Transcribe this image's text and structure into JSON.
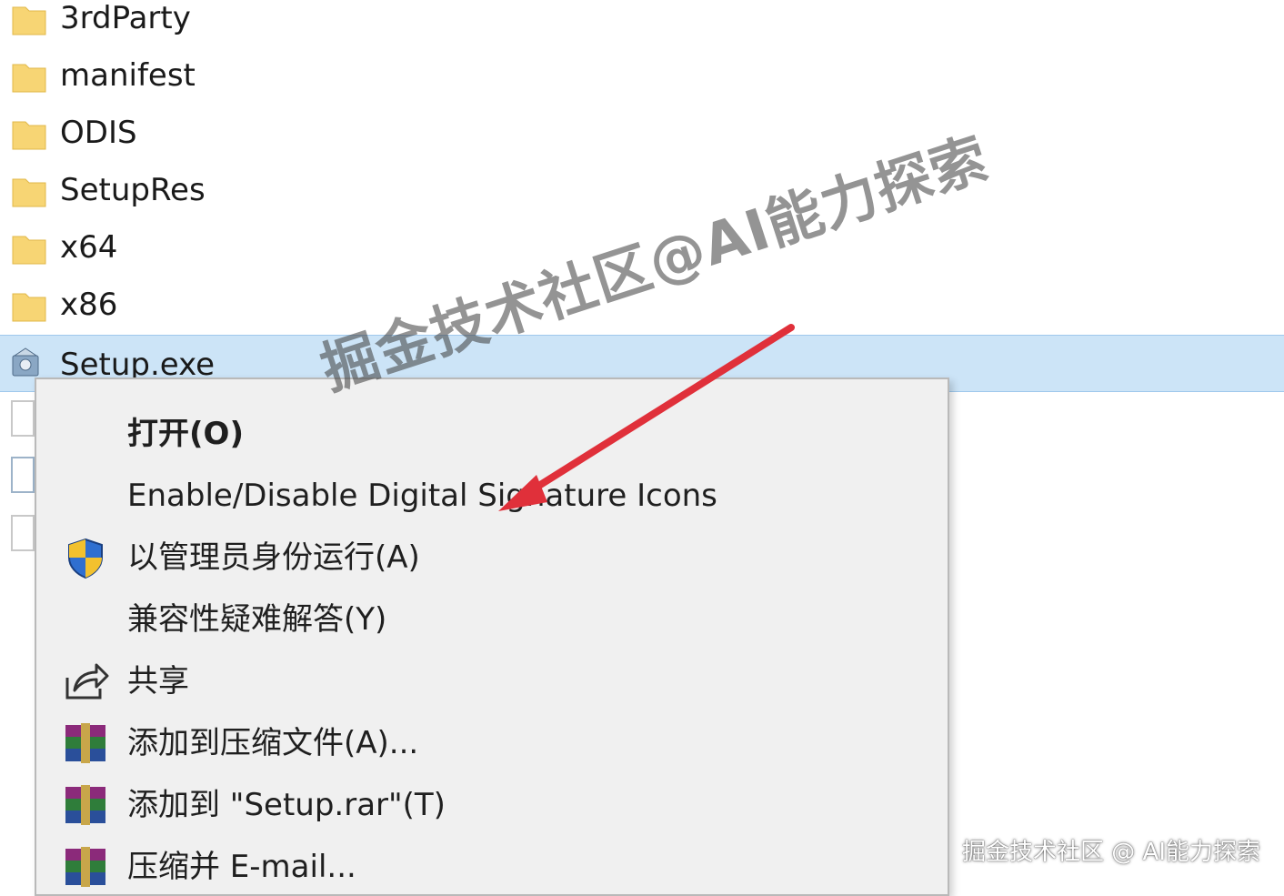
{
  "files": [
    {
      "name": "3rdParty",
      "type": "folder"
    },
    {
      "name": "manifest",
      "type": "folder"
    },
    {
      "name": "ODIS",
      "type": "folder"
    },
    {
      "name": "SetupRes",
      "type": "folder"
    },
    {
      "name": "x64",
      "type": "folder"
    },
    {
      "name": "x86",
      "type": "folder"
    },
    {
      "name": "Setup.exe",
      "type": "exe",
      "selected": true
    }
  ],
  "context_menu": {
    "items": [
      {
        "label": "打开(O)",
        "icon": null
      },
      {
        "label": "Enable/Disable Digital Signature Icons",
        "icon": null
      },
      {
        "label": "以管理员身份运行(A)",
        "icon": "uac-shield-icon"
      },
      {
        "label": "兼容性疑难解答(Y)",
        "icon": null
      },
      {
        "label": "共享",
        "icon": "share-icon"
      },
      {
        "label": "添加到压缩文件(A)...",
        "icon": "winrar-icon"
      },
      {
        "label": "添加到 \"Setup.rar\"(T)",
        "icon": "winrar-icon"
      },
      {
        "label": "压缩并 E-mail...",
        "icon": "winrar-icon"
      }
    ]
  },
  "watermark": "掘金技术社区@AI能力探索",
  "corner_watermark": "掘金技术社区 @ AI能力探索",
  "colors": {
    "selection": "#cce4f7",
    "menu_background": "#f0f0f0",
    "folder": "#f7d574",
    "arrow": "#e0303a"
  }
}
